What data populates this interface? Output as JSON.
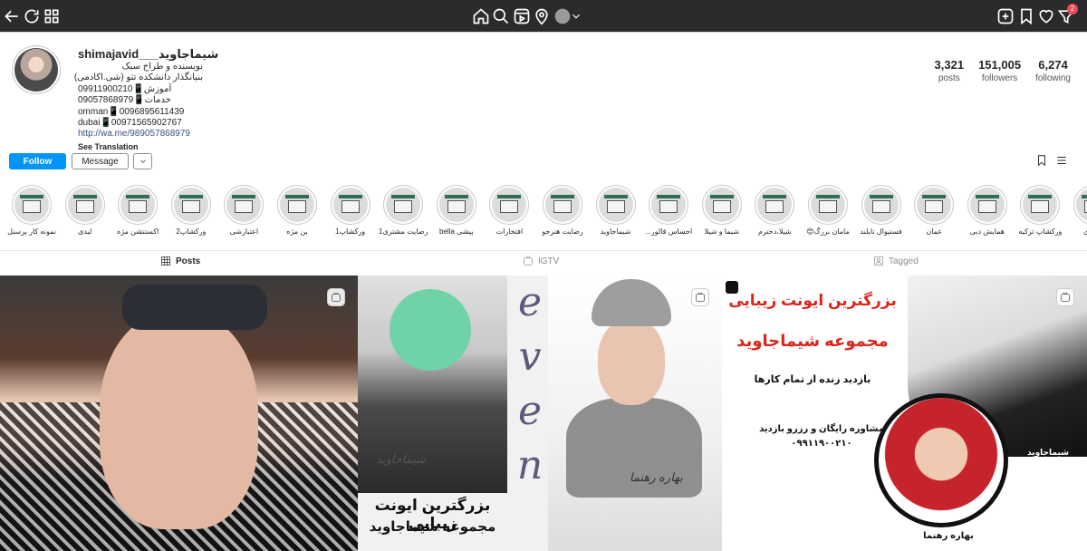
{
  "profile": {
    "username": "shimajavid___شیماجاوید",
    "bio_lines": [
      "نویسنده و طراح سبک",
      "بنیانگذار دانشکده تتو (شی.اکادمی)",
      "آموزش📱09911900210",
      "خدمات📱09057868979",
      "omman📱0096895611439",
      "dubai📱00971565902767"
    ],
    "link": "http://wa.me/989057868979",
    "see_translation": "See Translation"
  },
  "stats": [
    {
      "value": "3,321",
      "label": "posts"
    },
    {
      "value": "151,005",
      "label": "followers"
    },
    {
      "value": "6,274",
      "label": "following"
    }
  ],
  "buttons": {
    "follow": "Follow",
    "message": "Message"
  },
  "highlights": [
    {
      "label": "نمونه کار پرسنل"
    },
    {
      "label": "لیدی"
    },
    {
      "label": "اکستنشن مژه"
    },
    {
      "label": "ورکشاپ2"
    },
    {
      "label": "اعتبارشی"
    },
    {
      "label": "بن مژه"
    },
    {
      "label": "ورکشاپ1"
    },
    {
      "label": "رضایت مشتری1"
    },
    {
      "label": "پیشی bella"
    },
    {
      "label": "افتخارات"
    },
    {
      "label": "رضایت هنرجو"
    },
    {
      "label": "شیماجاوید"
    },
    {
      "label": "احساس قالور..."
    },
    {
      "label": "شیما و شیلا"
    },
    {
      "label": "شیلا،دخترم"
    },
    {
      "label": "مامان بزرگ😍"
    },
    {
      "label": "فستیوال تایلند"
    },
    {
      "label": "عمان"
    },
    {
      "label": "همایش دبی"
    },
    {
      "label": "ورکشاپ ترکیه"
    },
    {
      "label": "مجازی"
    }
  ],
  "tabs": [
    {
      "label": "Posts"
    },
    {
      "label": "IGTV"
    },
    {
      "label": "Tagged"
    }
  ],
  "posts": {
    "p2": {
      "letters": [
        "e",
        "v",
        "e",
        "n"
      ],
      "signature": "شیماجاوید",
      "caption1": "بزرگترین ایونت زیبایی",
      "caption2": "مجموعه شیماجاوید"
    },
    "p3": {
      "signature": "بهاره رهنما"
    },
    "p4": {
      "title1": "بزرگترین ایونت زیبایی",
      "title2": "مجموعه شیماجاوید",
      "subtitle": "بازدید زنده از تمام کارها",
      "info1": "مشاوره رایگان و رزرو بازدید",
      "info2": "۰۹۹۱۱۹۰۰۲۱۰",
      "name1": "بهاره رهنما",
      "name2": "شیماجاوید"
    }
  },
  "colors": {
    "topbar": "#2b2b2b",
    "follow": "#0095f6",
    "link": "#385185",
    "badge": "#ed4956",
    "accent_red": "#d9261c"
  },
  "notifications": {
    "count": "2"
  }
}
